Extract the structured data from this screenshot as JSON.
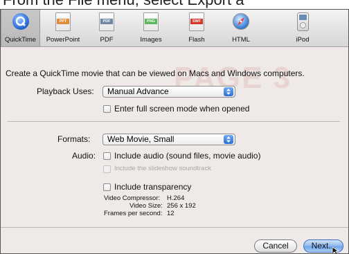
{
  "caption": "From the File menu, select Export a",
  "toolbar": {
    "items": [
      {
        "label": "QuickTime",
        "icon": "quicktime-icon",
        "band": "",
        "color": "#2f6fd8"
      },
      {
        "label": "PowerPoint",
        "icon": "powerpoint-icon",
        "band": "PPT",
        "color": "#e08a3a"
      },
      {
        "label": "PDF",
        "icon": "pdf-icon",
        "band": "PDF",
        "color": "#6f86a3"
      },
      {
        "label": "Images",
        "icon": "images-icon",
        "band": "PNG",
        "color": "#5cb85c"
      },
      {
        "label": "Flash",
        "icon": "flash-icon",
        "band": "SWF",
        "color": "#d9362b"
      },
      {
        "label": "HTML",
        "icon": "safari-compass-icon",
        "band": "",
        "color": "#3b82d6"
      },
      {
        "label": "iPod",
        "icon": "ipod-icon",
        "band": "",
        "color": "#bdbdbd"
      }
    ],
    "selected": "QuickTime"
  },
  "content": {
    "watermark": "PAGE 3",
    "description": "Create a QuickTime movie that can be viewed on Macs and Windows computers.",
    "playback_label": "Playback Uses:",
    "playback_value": "Manual Advance",
    "fullscreen_label": "Enter full screen mode when opened",
    "formats_label": "Formats:",
    "formats_value": "Web Movie, Small",
    "audio_label": "Audio:",
    "include_audio_label": "Include audio (sound files, movie audio)",
    "slideshow_soundtrack_label": "Include the slideshow soundtrack",
    "transparency_label": "Include transparency",
    "compressor_label": "Video Compressor:",
    "compressor_value": "H.264",
    "size_label": "Video Size:",
    "size_value": "256 x 192",
    "fps_label": "Frames per second:",
    "fps_value": "12"
  },
  "buttons": {
    "cancel": "Cancel",
    "next": "Next..."
  }
}
